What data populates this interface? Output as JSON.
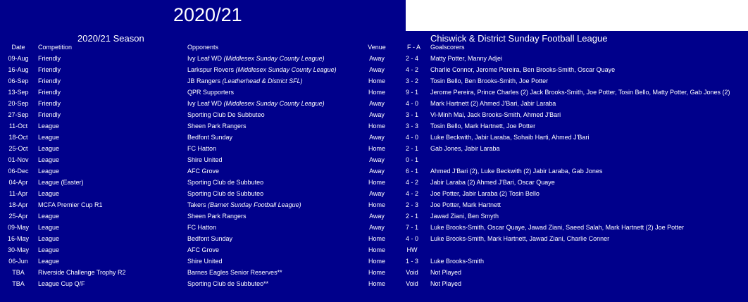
{
  "title": "2020/21",
  "season_label": "2020/21 Season",
  "league_label": "Chiswick & District Sunday Football League",
  "columns": {
    "date": "Date",
    "competition": "Competition",
    "opponents": "Opponents",
    "venue": "Venue",
    "score": "F - A",
    "scorers": "Goalscorers"
  },
  "fixtures": [
    {
      "date": "09-Aug",
      "competition": "Friendly",
      "opponent": "Ivy Leaf WD",
      "opponent_league": "(Middlesex Sunday County League)",
      "venue": "Away",
      "score": "2 - 4",
      "scorers": "Matty Potter, Manny Adjei"
    },
    {
      "date": "16-Aug",
      "competition": "Friendly",
      "opponent": "Larkspur Rovers",
      "opponent_league": "(Middlesex Sunday County League)",
      "venue": "Away",
      "score": "4 - 2",
      "scorers": "Charlie Connor, Jerome Pereira, Ben Brooks-Smith, Oscar Quaye"
    },
    {
      "date": "06-Sep",
      "competition": "Friendly",
      "opponent": "JB Rangers",
      "opponent_league": "(Leatherhead & District SFL)",
      "venue": "Home",
      "score": "3 - 2",
      "scorers": "Tosin Bello, Ben Brooks-Smith, Joe Potter"
    },
    {
      "date": "13-Sep",
      "competition": "Friendly",
      "opponent": "QPR Supporters",
      "opponent_league": "",
      "venue": "Home",
      "score": "9 - 1",
      "scorers": "Jerome Pereira, Prince Charles (2) Jack Brooks-Smith, Joe Potter, Tosin Bello, Matty Potter, Gab Jones (2)"
    },
    {
      "date": "20-Sep",
      "competition": "Friendly",
      "opponent": "Ivy Leaf WD",
      "opponent_league": "(Middlesex Sunday County League)",
      "venue": "Away",
      "score": "4 - 0",
      "scorers": "Mark Hartnett (2) Ahmed J'Bari, Jabir Laraba"
    },
    {
      "date": "27-Sep",
      "competition": "Friendly",
      "opponent": "Sporting Club De Subbuteo",
      "opponent_league": "",
      "venue": "Away",
      "score": "3 - 1",
      "scorers": "Vi-Minh Mai, Jack Brooks-Smith, Ahmed J'Bari"
    },
    {
      "date": "11-Oct",
      "competition": "League",
      "opponent": "Sheen Park Rangers",
      "opponent_league": "",
      "venue": "Home",
      "score": "3 - 3",
      "scorers": "Tosin Bello, Mark Hartnett, Joe Potter"
    },
    {
      "date": "18-Oct",
      "competition": "League",
      "opponent": "Bedfont Sunday",
      "opponent_league": "",
      "venue": "Away",
      "score": "4 - 0",
      "scorers": "Luke Beckwith, Jabir Laraba, Sohaib Harti, Ahmed J'Bari"
    },
    {
      "date": "25-Oct",
      "competition": "League",
      "opponent": "FC Hatton",
      "opponent_league": "",
      "venue": "Home",
      "score": "2 - 1",
      "scorers": "Gab Jones, Jabir Laraba"
    },
    {
      "date": "01-Nov",
      "competition": "League",
      "opponent": "Shire United",
      "opponent_league": "",
      "venue": "Away",
      "score": "0 - 1",
      "scorers": ""
    },
    {
      "date": "06-Dec",
      "competition": "League",
      "opponent": "AFC Grove",
      "opponent_league": "",
      "venue": "Away",
      "score": "6 - 1",
      "scorers": "Ahmed J'Bari (2), Luke Beckwith (2) Jabir Laraba, Gab Jones"
    },
    {
      "date": "04-Apr",
      "competition": "League (Easter)",
      "opponent": "Sporting Club de Subbuteo",
      "opponent_league": "",
      "venue": "Home",
      "score": "4 - 2",
      "scorers": "Jabir Laraba (2) Ahmed J'Bari, Oscar Quaye"
    },
    {
      "date": "11-Apr",
      "competition": "League",
      "opponent": "Sporting Club de Subbuteo",
      "opponent_league": "",
      "venue": "Away",
      "score": "4 - 2",
      "scorers": "Joe Potter, Jabir Laraba (2) Tosin Bello"
    },
    {
      "date": "18-Apr",
      "competition": "MCFA Premier Cup R1",
      "opponent": "Takers",
      "opponent_league": "(Barnet Sunday Football League)",
      "venue": "Home",
      "score": "2 - 3",
      "scorers": "Joe Potter, Mark Hartnett"
    },
    {
      "date": "25-Apr",
      "competition": "League",
      "opponent": "Sheen Park Rangers",
      "opponent_league": "",
      "venue": "Away",
      "score": "2 - 1",
      "scorers": "Jawad Ziani, Ben Smyth"
    },
    {
      "date": "09-May",
      "competition": "League",
      "opponent": "FC Hatton",
      "opponent_league": "",
      "venue": "Away",
      "score": "7 - 1",
      "scorers": "Luke Brooks-Smith, Oscar Quaye, Jawad Ziani, Saeed Salah, Mark Hartnett (2) Joe Potter"
    },
    {
      "date": "16-May",
      "competition": "League",
      "opponent": "Bedfont Sunday",
      "opponent_league": "",
      "venue": "Home",
      "score": "4 - 0",
      "scorers": "Luke Brooks-Smith, Mark Hartnett, Jawad Ziani, Charlie Conner"
    },
    {
      "date": "30-May",
      "competition": "League",
      "opponent": "AFC Grove",
      "opponent_league": "",
      "venue": "Home",
      "score": "HW",
      "scorers": ""
    },
    {
      "date": "06-Jun",
      "competition": "League",
      "opponent": "Shire United",
      "opponent_league": "",
      "venue": "Home",
      "score": "1 - 3",
      "scorers": "Luke Brooks-Smith"
    },
    {
      "date": "TBA",
      "competition": "Riverside Challenge Trophy R2",
      "opponent": "Barnes Eagles Senior Reserves**",
      "opponent_league": "",
      "venue": "Home",
      "score": "Void",
      "scorers": "Not Played"
    },
    {
      "date": "TBA",
      "competition": "League Cup Q/F",
      "opponent": "Sporting Club de Subbuteo**",
      "opponent_league": "",
      "venue": "Home",
      "score": "Void",
      "scorers": "Not Played"
    }
  ],
  "colors": {
    "background": "#00008b",
    "text": "#ffffff",
    "header_block": "#ffffff"
  }
}
